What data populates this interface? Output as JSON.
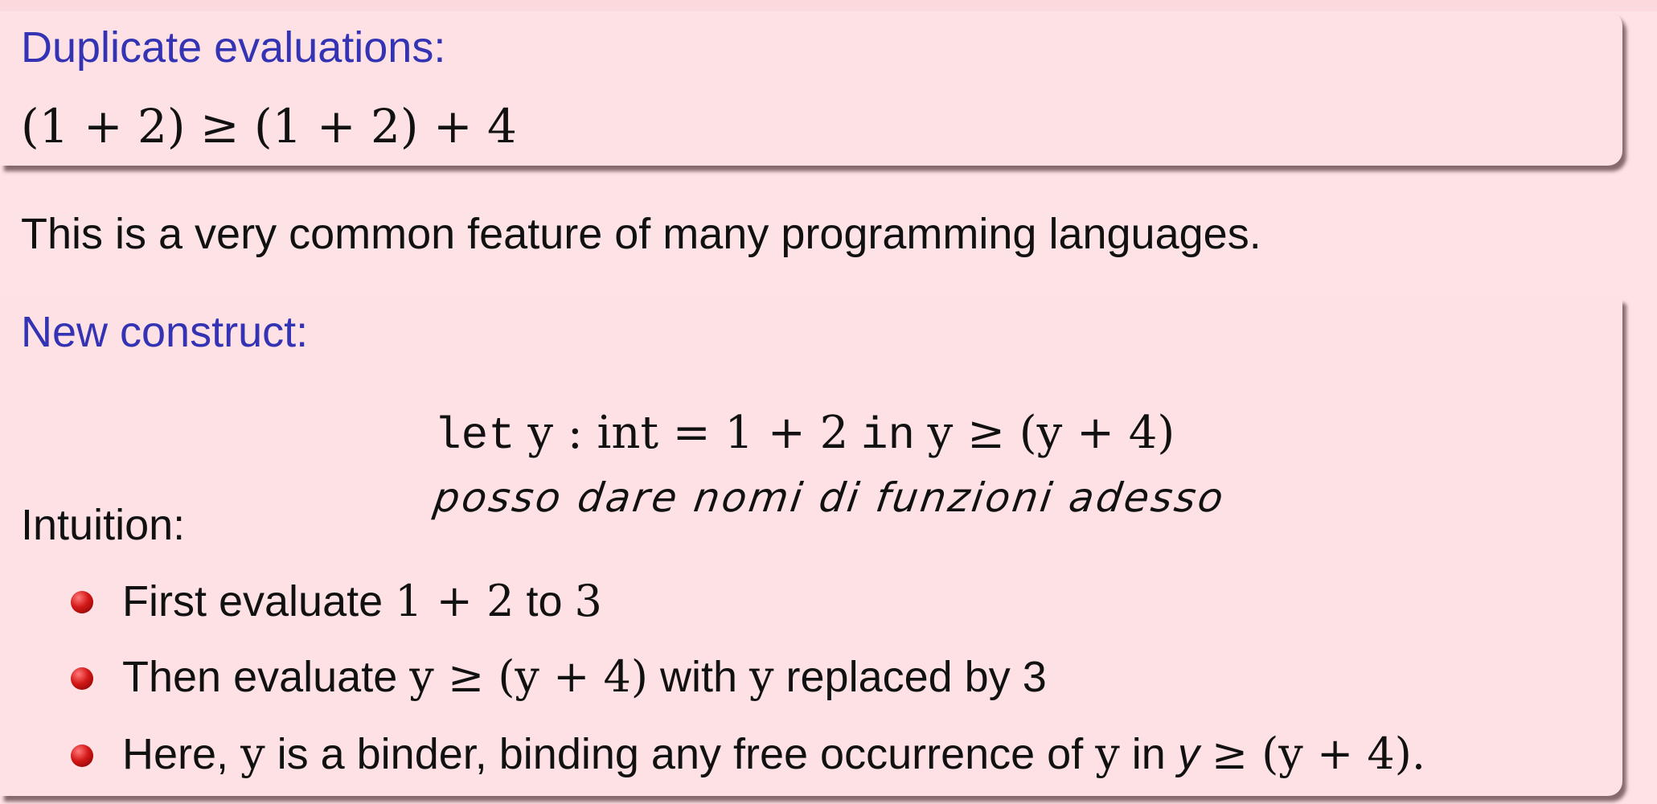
{
  "block1": {
    "heading": "Duplicate evaluations:",
    "formula": "(1 + 2) ≥ (1 + 2) + 4"
  },
  "paragraph": "This is a very common feature of many programming languages.",
  "block2": {
    "heading": "New construct:",
    "code": {
      "let": "let",
      "binding": "y : int = 1 + 2",
      "in": "in",
      "body": "y ≥ (y + 4)"
    },
    "handwritten_note": "posso dare nomi di funzioni adesso",
    "intuition_label": "Intuition:",
    "bullets": [
      {
        "text_before": "First evaluate",
        "math": "1 + 2",
        "text_mid": "to",
        "math2": "3"
      },
      {
        "text_before": "Then evaluate",
        "math": "y ≥ (y + 4)",
        "text_mid": "with",
        "math2": "y",
        "text_after": "replaced by 3"
      },
      {
        "text_before": "Here,",
        "math": "y",
        "text_mid": "is a binder, binding any free occurrence of",
        "math2": "y",
        "text_in": "in",
        "italic": "y",
        "math3": "≥ (y + 4)."
      }
    ]
  },
  "colors": {
    "heading": "#3333b3",
    "background": "#fde3e6",
    "bullet": "#d41818"
  }
}
